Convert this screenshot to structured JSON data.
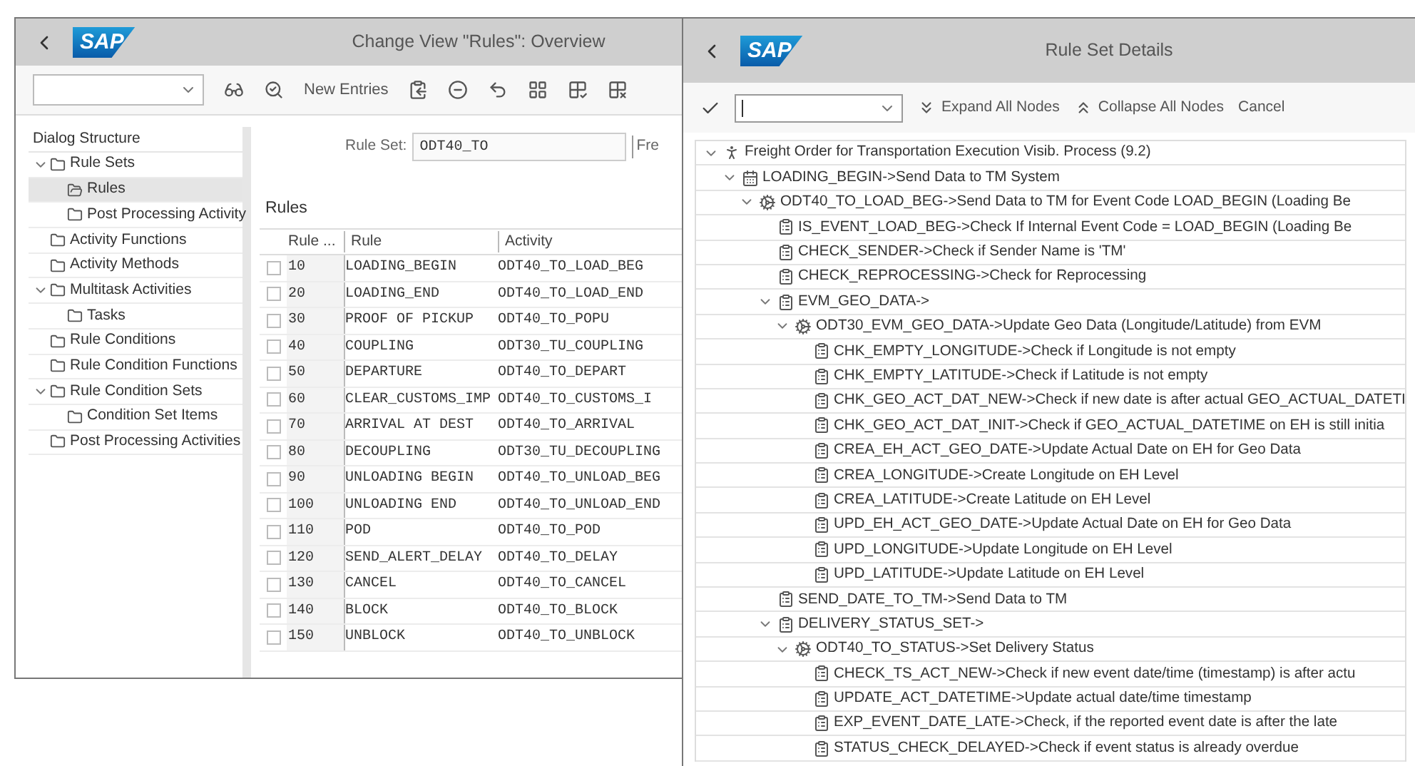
{
  "left_window": {
    "logo": "SAP",
    "title": "Change View \"Rules\": Overview",
    "toolbar": {
      "new_entries_button": "New Entries"
    },
    "dialog_structure": {
      "title": "Dialog Structure",
      "items": [
        {
          "label": "Rule Sets",
          "selected": false,
          "expanded": true,
          "children": [
            {
              "label": "Rules",
              "selected": true
            },
            {
              "label": "Post Processing Activity",
              "selected": false
            }
          ]
        },
        {
          "label": "Activity Functions",
          "selected": false
        },
        {
          "label": "Activity Methods",
          "selected": false
        },
        {
          "label": "Multitask Activities",
          "selected": false,
          "expanded": true,
          "children": [
            {
              "label": "Tasks",
              "selected": false
            }
          ]
        },
        {
          "label": "Rule Conditions",
          "selected": false
        },
        {
          "label": "Rule Condition Functions",
          "selected": false
        },
        {
          "label": "Rule Condition Sets",
          "selected": false,
          "expanded": true,
          "children": [
            {
              "label": "Condition Set Items",
              "selected": false
            }
          ]
        },
        {
          "label": "Post Processing Activities",
          "selected": false
        }
      ]
    },
    "rule_set": {
      "label": "Rule Set:",
      "value": "ODT40_TO",
      "next_label": "Fre"
    },
    "rules_table": {
      "title": "Rules",
      "columns": [
        "Rule ...",
        "Rule",
        "Activity"
      ],
      "rows": [
        {
          "selected": false,
          "cells": [
            "10",
            "LOADING_BEGIN",
            "ODT40_TO_LOAD_BEG"
          ]
        },
        {
          "selected": false,
          "cells": [
            "20",
            "LOADING_END",
            "ODT40_TO_LOAD_END"
          ]
        },
        {
          "selected": false,
          "cells": [
            "30",
            "PROOF OF PICKUP",
            "ODT40_TO_POPU"
          ]
        },
        {
          "selected": false,
          "cells": [
            "40",
            "COUPLING",
            "ODT30_TU_COUPLING"
          ]
        },
        {
          "selected": false,
          "cells": [
            "50",
            "DEPARTURE",
            "ODT40_TO_DEPART"
          ]
        },
        {
          "selected": false,
          "cells": [
            "60",
            "CLEAR_CUSTOMS_IMP",
            "ODT40_TO_CUSTOMS_I"
          ]
        },
        {
          "selected": false,
          "cells": [
            "70",
            "ARRIVAL AT DEST",
            "ODT40_TO_ARRIVAL"
          ]
        },
        {
          "selected": false,
          "cells": [
            "80",
            "DECOUPLING",
            "ODT30_TU_DECOUPLING"
          ]
        },
        {
          "selected": false,
          "cells": [
            "90",
            "UNLOADING BEGIN",
            "ODT40_TO_UNLOAD_BEG"
          ]
        },
        {
          "selected": false,
          "cells": [
            "100",
            "UNLOADING END",
            "ODT40_TO_UNLOAD_END"
          ]
        },
        {
          "selected": false,
          "cells": [
            "110",
            "POD",
            "ODT40_TO_POD"
          ]
        },
        {
          "selected": false,
          "cells": [
            "120",
            "SEND_ALERT_DELAY",
            "ODT40_TO_DELAY"
          ]
        },
        {
          "selected": false,
          "cells": [
            "130",
            "CANCEL",
            "ODT40_TO_CANCEL"
          ]
        },
        {
          "selected": false,
          "cells": [
            "140",
            "BLOCK",
            "ODT40_TO_BLOCK"
          ]
        },
        {
          "selected": false,
          "cells": [
            "150",
            "UNBLOCK",
            "ODT40_TO_UNBLOCK"
          ]
        }
      ]
    }
  },
  "right_window": {
    "logo": "SAP",
    "title": "Rule Set Details",
    "toolbar": {
      "expand_button": "Expand All Nodes",
      "collapse_button": "Collapse All Nodes",
      "cancel_button": "Cancel"
    },
    "tree": [
      {
        "kind": "process",
        "label": "Freight Order for Transportation Execution Visib. Process (9.2)",
        "expanded": true,
        "children": [
          {
            "kind": "rule",
            "label": "LOADING_BEGIN->Send Data to TM System",
            "expanded": true,
            "children": [
              {
                "kind": "activity",
                "label": "ODT40_TO_LOAD_BEG->Send Data to TM for Event Code LOAD_BEGIN (Loading Be",
                "expanded": true,
                "children": [
                  {
                    "kind": "condition",
                    "label": "IS_EVENT_LOAD_BEG->Check If Internal Event Code = LOAD_BEGIN (Loading Be"
                  },
                  {
                    "kind": "condition",
                    "label": "CHECK_SENDER->Check if Sender Name is 'TM'"
                  },
                  {
                    "kind": "condition",
                    "label": "CHECK_REPROCESSING->Check for Reprocessing"
                  },
                  {
                    "kind": "condition",
                    "label": "EVM_GEO_DATA->",
                    "expanded": true,
                    "children": [
                      {
                        "kind": "activity",
                        "label": "ODT30_EVM_GEO_DATA->Update Geo Data (Longitude/Latitude) from EVM",
                        "expanded": true,
                        "children": [
                          {
                            "kind": "condition",
                            "label": "CHK_EMPTY_LONGITUDE->Check if Longitude is not empty"
                          },
                          {
                            "kind": "condition",
                            "label": "CHK_EMPTY_LATITUDE->Check if Latitude is not empty"
                          },
                          {
                            "kind": "condition",
                            "label": "CHK_GEO_ACT_DAT_NEW->Check if new date is after actual GEO_ACTUAL_DATETI"
                          },
                          {
                            "kind": "condition",
                            "label": "CHK_GEO_ACT_DAT_INIT->Check if GEO_ACTUAL_DATETIME on EH is still initia"
                          },
                          {
                            "kind": "condition",
                            "label": "CREA_EH_ACT_GEO_DATE->Update Actual Date on EH for Geo Data"
                          },
                          {
                            "kind": "condition",
                            "label": "CREA_LONGITUDE->Create Longitude on EH Level"
                          },
                          {
                            "kind": "condition",
                            "label": "CREA_LATITUDE->Create Latitude on EH Level"
                          },
                          {
                            "kind": "condition",
                            "label": "UPD_EH_ACT_GEO_DATE->Update Actual Date on EH for Geo Data"
                          },
                          {
                            "kind": "condition",
                            "label": "UPD_LONGITUDE->Update Longitude on EH Level"
                          },
                          {
                            "kind": "condition",
                            "label": "UPD_LATITUDE->Update Latitude on EH Level"
                          }
                        ]
                      }
                    ]
                  },
                  {
                    "kind": "condition",
                    "label": "SEND_DATE_TO_TM->Send Data to TM"
                  },
                  {
                    "kind": "condition",
                    "label": "DELIVERY_STATUS_SET->",
                    "expanded": true,
                    "children": [
                      {
                        "kind": "activity",
                        "label": "ODT40_TO_STATUS->Set Delivery Status",
                        "expanded": true,
                        "children": [
                          {
                            "kind": "condition",
                            "label": "CHECK_TS_ACT_NEW->Check if new event date/time (timestamp) is after actu"
                          },
                          {
                            "kind": "condition",
                            "label": "UPDATE_ACT_DATETIME->Update actual date/time timestamp"
                          },
                          {
                            "kind": "condition",
                            "label": "EXP_EVENT_DATE_LATE->Check, if the reported event date is after the late"
                          },
                          {
                            "kind": "condition",
                            "label": "STATUS_CHECK_DELAYED->Check if event status is already overdue"
                          }
                        ]
                      }
                    ]
                  }
                ]
              }
            ]
          }
        ]
      }
    ]
  }
}
